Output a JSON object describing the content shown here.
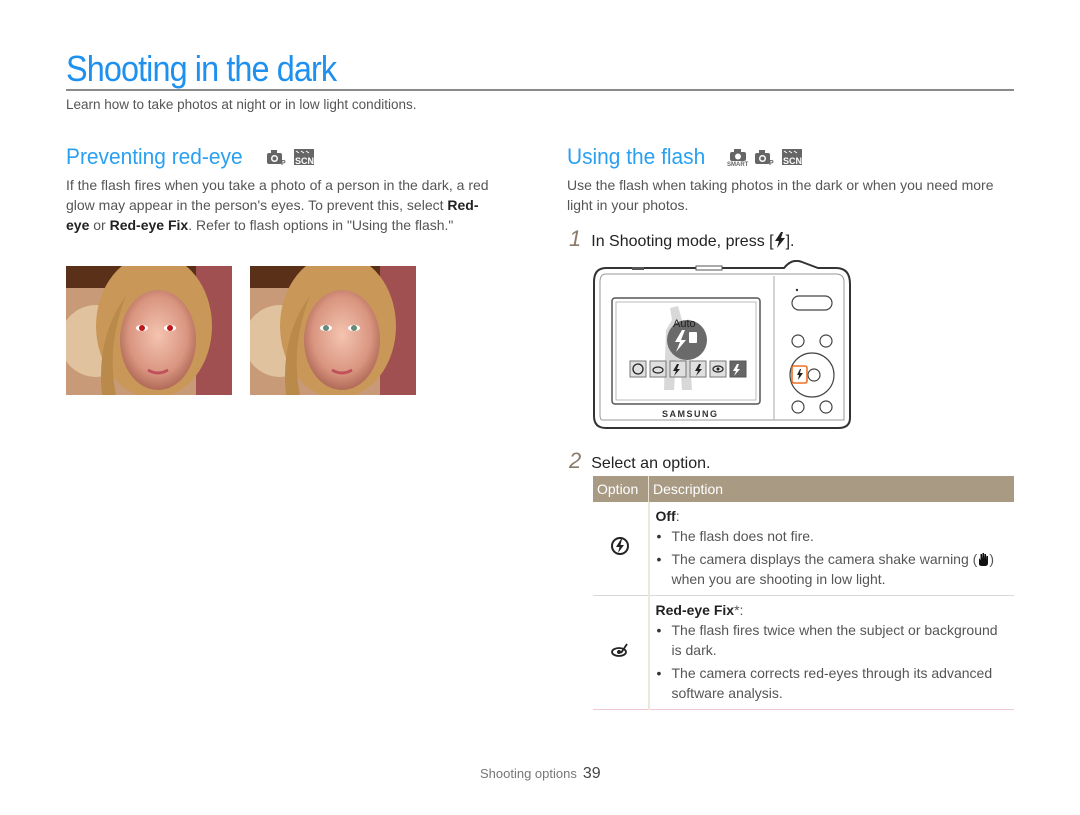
{
  "page": {
    "title": "Shooting in the dark",
    "subtitle": "Learn how to take photos at night or in low light conditions.",
    "accent_color": "#1e90f0",
    "table_header_color": "#a99a84"
  },
  "left": {
    "heading": "Preventing red-eye",
    "mode_icons": [
      "program-mode-icon",
      "scene-mode-icon"
    ],
    "paragraph": {
      "p1": "If the flash fires when you take a photo of a person in the dark, a red glow may appear in the person's eyes. To prevent this, select ",
      "bold1": "Red-eye",
      "p2": " or ",
      "bold2": "Red-eye Fix",
      "p3": ". Refer to flash options in \"Using the flash.\""
    },
    "photos": [
      {
        "name": "photo-red-eye",
        "description": "woman with red eyes"
      },
      {
        "name": "photo-red-eye-fixed",
        "description": "woman with corrected eyes"
      }
    ]
  },
  "right": {
    "heading": "Using the flash",
    "mode_icons": [
      "smart-auto-mode-icon",
      "program-mode-icon",
      "scene-mode-icon"
    ],
    "intro": "Use the flash when taking photos in the dark or when you need more light in your photos.",
    "steps": [
      {
        "num": "1",
        "pre": "In Shooting mode, press [",
        "key": "flash-key",
        "post": "]."
      },
      {
        "num": "2",
        "text": "Select an option."
      }
    ],
    "camera": {
      "screen_label": "Auto",
      "brand": "SAMSUNG",
      "flash_options": [
        "off",
        "red-eye-fix",
        "slow-sync",
        "fill-in",
        "red-eye",
        "auto"
      ],
      "selected_option": "auto",
      "highlight_color": "#f07020"
    },
    "table": {
      "headers": [
        "Option",
        "Description"
      ],
      "rows": [
        {
          "icon": "flash-off-icon",
          "name": "Off",
          "suffix": ":",
          "bullets": [
            "The flash does not fire.",
            "The camera displays the camera shake warning (",
            "when you are shooting in low light."
          ]
        },
        {
          "icon": "red-eye-fix-icon",
          "name": "Red-eye Fix",
          "suffix": "*:",
          "bullets": [
            "The flash fires twice when the subject or background is dark.",
            "The camera corrects red-eyes through its advanced software analysis."
          ]
        }
      ]
    }
  },
  "footer": {
    "section": "Shooting options",
    "page_number": "39"
  }
}
